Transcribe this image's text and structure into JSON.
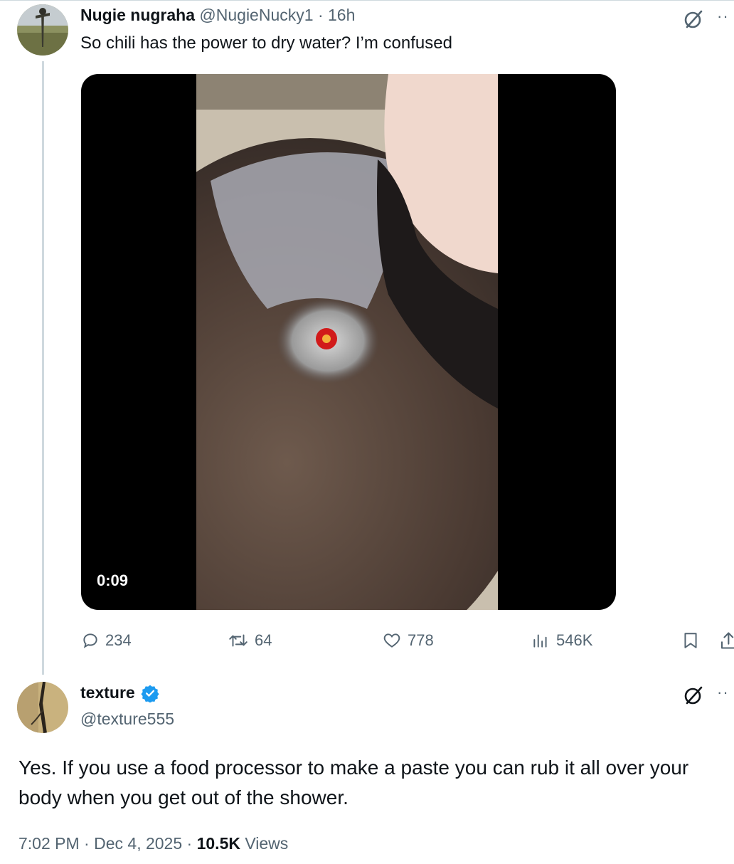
{
  "parent": {
    "name": "Nugie nugraha",
    "handle": "@NugieNucky1",
    "separator": "·",
    "time": "16h",
    "text": "So chili has the power to dry water? I’m confused",
    "video": {
      "duration": "0:09"
    },
    "actions": {
      "replies": "234",
      "retweets": "64",
      "likes": "778",
      "views": "546K"
    },
    "more_icon": "more-icon",
    "grok_icon": "grok-icon"
  },
  "reply": {
    "name": "texture",
    "verified": true,
    "handle": "@texture555",
    "text": "Yes. If you use a food processor to make a paste you can rub it all over your body when you get out of the shower.",
    "time": "7:02 PM",
    "date": "Dec 4, 2025",
    "views_count": "10.5K",
    "views_label": "Views",
    "separator": "·"
  },
  "colors": {
    "text_primary": "#0f1419",
    "text_secondary": "#536471",
    "verified_blue": "#1d9bf0",
    "divider": "#cfd9de"
  }
}
